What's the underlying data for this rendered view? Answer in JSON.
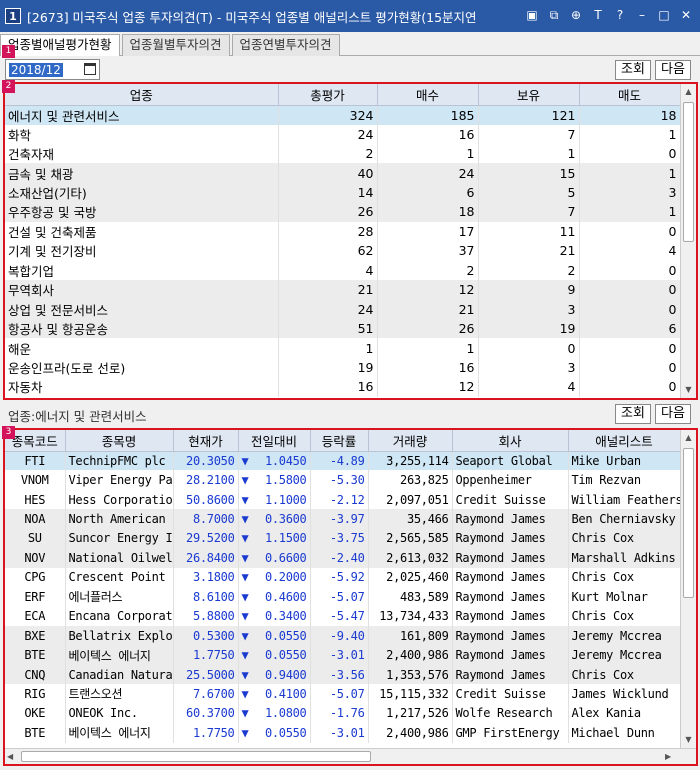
{
  "window": {
    "number": "1",
    "title": "[2673] 미국주식 업종 투자의견(T) - 미국주식 업종별 애널리스트 평가현황(15분지연"
  },
  "tabs": [
    "업종별애널평가현황",
    "업종월별투자의견",
    "업종연별투자의견"
  ],
  "markers": [
    "1",
    "2",
    "3"
  ],
  "date": "2018/12",
  "buttons": {
    "query": "조회",
    "next": "다음"
  },
  "sector_table": {
    "headers": [
      "업종",
      "총평가",
      "매수",
      "보유",
      "매도"
    ],
    "rows": [
      [
        "에너지 및 관련서비스",
        "324",
        "185",
        "121",
        "18"
      ],
      [
        "화학",
        "24",
        "16",
        "7",
        "1"
      ],
      [
        "건축자재",
        "2",
        "1",
        "1",
        "0"
      ],
      [
        "금속 및 채광",
        "40",
        "24",
        "15",
        "1"
      ],
      [
        "소재산업(기타)",
        "14",
        "6",
        "5",
        "3"
      ],
      [
        "우주항공 및 국방",
        "26",
        "18",
        "7",
        "1"
      ],
      [
        "건설 및 건축제품",
        "28",
        "17",
        "11",
        "0"
      ],
      [
        "기계 및 전기장비",
        "62",
        "37",
        "21",
        "4"
      ],
      [
        "복합기업",
        "4",
        "2",
        "2",
        "0"
      ],
      [
        "무역회사",
        "21",
        "12",
        "9",
        "0"
      ],
      [
        "상업 및 전문서비스",
        "24",
        "21",
        "3",
        "0"
      ],
      [
        "항공사 및 항공운송",
        "51",
        "26",
        "19",
        "6"
      ],
      [
        "해운",
        "1",
        "1",
        "0",
        "0"
      ],
      [
        "운송인프라(도로 선로)",
        "19",
        "16",
        "3",
        "0"
      ],
      [
        "자동차",
        "16",
        "12",
        "4",
        "0"
      ]
    ]
  },
  "sector_info": "업종:에너지 및 관련서비스",
  "stock_table": {
    "headers": [
      "종목코드",
      "종목명",
      "현재가",
      "전일대비",
      "등락률",
      "거래량",
      "회사",
      "애널리스트"
    ],
    "rows": [
      [
        "FTI",
        "TechnipFMC plc O",
        "20.3050",
        "1.0450",
        "-4.89",
        "3,255,114",
        "Seaport Global",
        "Mike Urban"
      ],
      [
        "VNOM",
        "Viper Energy Par",
        "28.2100",
        "1.5800",
        "-5.30",
        "263,825",
        "Oppenheimer",
        "Tim Rezvan"
      ],
      [
        "HES",
        "Hess Corporation",
        "50.8600",
        "1.1000",
        "-2.12",
        "2,097,051",
        "Credit Suisse",
        "William Featherst"
      ],
      [
        "NOA",
        "North American C",
        "8.7000",
        "0.3600",
        "-3.97",
        "35,466",
        "Raymond James",
        "Ben Cherniavsky"
      ],
      [
        "SU",
        "Suncor Energy  I",
        "29.5200",
        "1.1500",
        "-3.75",
        "2,565,585",
        "Raymond James",
        "Chris Cox"
      ],
      [
        "NOV",
        "National Oilwell",
        "26.8400",
        "0.6600",
        "-2.40",
        "2,613,032",
        "Raymond James",
        "Marshall Adkins"
      ],
      [
        "CPG",
        "Crescent Point E",
        "3.1800",
        "0.2000",
        "-5.92",
        "2,025,460",
        "Raymond James",
        "Chris Cox"
      ],
      [
        "ERF",
        "에너플러스",
        "8.6100",
        "0.4600",
        "-5.07",
        "483,589",
        "Raymond James",
        "Kurt Molnar"
      ],
      [
        "ECA",
        "Encana Corporati",
        "5.8800",
        "0.3400",
        "-5.47",
        "13,734,433",
        "Raymond James",
        "Chris Cox"
      ],
      [
        "BXE",
        "Bellatrix Explor",
        "0.5300",
        "0.0550",
        "-9.40",
        "161,809",
        "Raymond James",
        "Jeremy Mccrea"
      ],
      [
        "BTE",
        "베이텍스 에너지",
        "1.7750",
        "0.0550",
        "-3.01",
        "2,400,986",
        "Raymond James",
        "Jeremy Mccrea"
      ],
      [
        "CNQ",
        "Canadian Natural",
        "25.5000",
        "0.9400",
        "-3.56",
        "1,353,576",
        "Raymond James",
        "Chris Cox"
      ],
      [
        "RIG",
        "트랜스오션",
        "7.6700",
        "0.4100",
        "-5.07",
        "15,115,332",
        "Credit Suisse",
        "James Wicklund"
      ],
      [
        "OKE",
        "ONEOK  Inc.",
        "60.3700",
        "1.0800",
        "-1.76",
        "1,217,526",
        "Wolfe Research",
        "Alex Kania"
      ],
      [
        "BTE",
        "베이텍스 에너지",
        "1.7750",
        "0.0550",
        "-3.01",
        "2,400,986",
        "GMP FirstEnergy",
        "Michael Dunn"
      ]
    ]
  },
  "colors": {
    "titlebar": "#2a5aa6",
    "highlight_border": "#d9141e",
    "marker": "#d4145a",
    "selected_row": "#cfe6f5",
    "down": "#1a3ad0"
  },
  "icons": [
    "window-number-icon",
    "layout-icon",
    "copy-icon",
    "link-icon",
    "font-icon",
    "help-icon",
    "minimize-icon",
    "maximize-icon",
    "close-icon",
    "calendar-icon",
    "down-arrow-icon"
  ]
}
